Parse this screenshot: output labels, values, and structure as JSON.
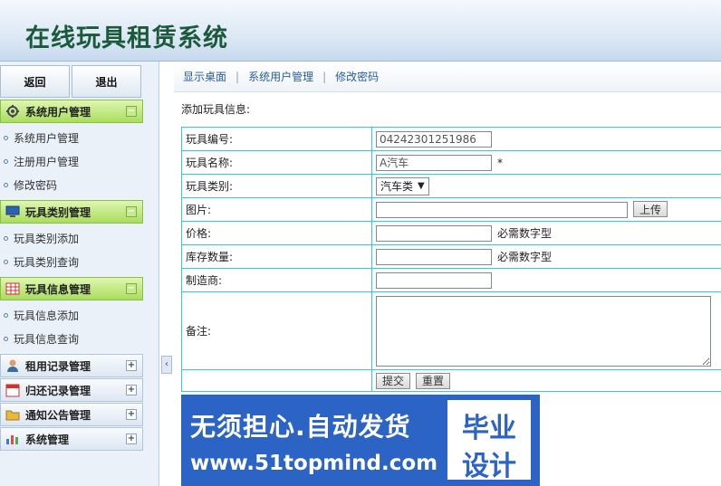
{
  "header": {
    "title": "在线玩具租赁系统"
  },
  "sidebar": {
    "back_label": "返回",
    "logout_label": "退出",
    "groups": [
      {
        "label": "系统用户管理",
        "expanded": true,
        "icon": "gear-icon",
        "items": [
          "系统用户管理",
          "注册用户管理",
          "修改密码"
        ]
      },
      {
        "label": "玩具类别管理",
        "expanded": true,
        "icon": "monitor-icon",
        "items": [
          "玩具类别添加",
          "玩具类别查询"
        ]
      },
      {
        "label": "玩具信息管理",
        "expanded": true,
        "icon": "table-icon",
        "items": [
          "玩具信息添加",
          "玩具信息查询"
        ]
      },
      {
        "label": "租用记录管理",
        "expanded": false,
        "icon": "user-icon",
        "items": []
      },
      {
        "label": "归还记录管理",
        "expanded": false,
        "icon": "calendar-icon",
        "items": []
      },
      {
        "label": "通知公告管理",
        "expanded": false,
        "icon": "folder-icon",
        "items": []
      },
      {
        "label": "系统管理",
        "expanded": false,
        "icon": "chart-icon",
        "items": []
      }
    ],
    "toggle_expanded": "−",
    "toggle_collapsed": "+",
    "collapse_handle": "‹"
  },
  "breadcrumb": [
    "显示桌面",
    "系统用户管理",
    "修改密码"
  ],
  "form": {
    "section_title": "添加玩具信息:",
    "fields": {
      "toy_no": {
        "label": "玩具编号:",
        "value": "04242301251986"
      },
      "toy_name": {
        "label": "玩具名称:",
        "value": "A汽车",
        "required": "*"
      },
      "toy_category": {
        "label": "玩具类别:",
        "selected": "汽车类",
        "arrow": "▼"
      },
      "image": {
        "label": "图片:",
        "upload_label": "上传"
      },
      "price": {
        "label": "价格:",
        "hint": "必需数字型"
      },
      "stock": {
        "label": "库存数量:",
        "hint": "必需数字型"
      },
      "maker": {
        "label": "制造商:"
      },
      "remark": {
        "label": "备注:"
      }
    },
    "submit_label": "提交",
    "reset_label": "重置"
  },
  "banner": {
    "line1": "无须担心.自动发货",
    "line2": "www.51topmind.com",
    "badge_line1": "毕业",
    "badge_line2": "设计"
  }
}
